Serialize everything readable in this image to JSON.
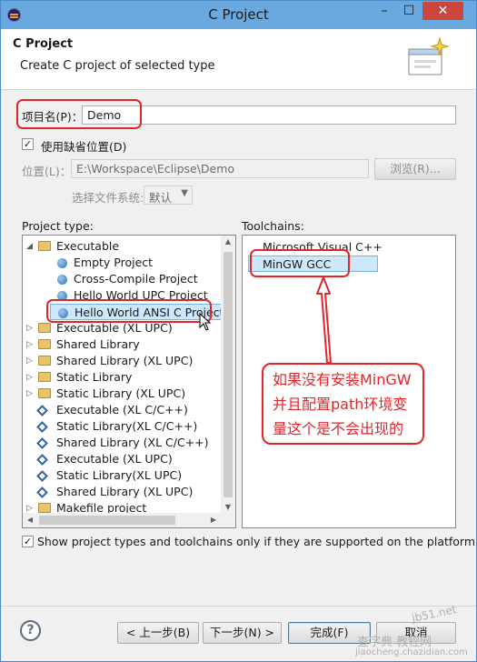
{
  "window": {
    "title": "C Project",
    "min": "–",
    "max": "☐",
    "close": "✕"
  },
  "header": {
    "title": "C Project",
    "description": "Create C project of selected type"
  },
  "project_name": {
    "label": "项目名(P)：",
    "value": "Demo"
  },
  "default_location": {
    "label": "使用缺省位置(D)",
    "checked": true
  },
  "location": {
    "label": "位置(L)：",
    "value": "E:\\Workspace\\Eclipse\\Demo",
    "browse": "浏览(R)..."
  },
  "filesystem": {
    "label": "选择文件系统:",
    "value": "默认"
  },
  "project_type": {
    "label": "Project type:",
    "items": [
      {
        "label": "Executable",
        "icon": "folder",
        "expander": "◢",
        "level": 0
      },
      {
        "label": "Empty Project",
        "icon": "circle",
        "level": 1
      },
      {
        "label": "Cross-Compile Project",
        "icon": "circle",
        "level": 1
      },
      {
        "label": "Hello World UPC Project",
        "icon": "circle",
        "level": 1
      },
      {
        "label": "Hello World ANSI C Project",
        "icon": "circle",
        "level": 1,
        "selected": true
      },
      {
        "label": "Executable (XL UPC)",
        "icon": "folder",
        "expander": "▷",
        "level": 0
      },
      {
        "label": "Shared Library",
        "icon": "folder",
        "expander": "▷",
        "level": 0
      },
      {
        "label": "Shared Library (XL UPC)",
        "icon": "folder",
        "expander": "▷",
        "level": 0
      },
      {
        "label": "Static Library",
        "icon": "folder",
        "expander": "▷",
        "level": 0
      },
      {
        "label": "Static Library (XL UPC)",
        "icon": "folder",
        "expander": "▷",
        "level": 0
      },
      {
        "label": "Executable (XL C/C++)",
        "icon": "diamond",
        "level": 0
      },
      {
        "label": "Static Library(XL C/C++)",
        "icon": "diamond",
        "level": 0
      },
      {
        "label": "Shared Library (XL C/C++)",
        "icon": "diamond",
        "level": 0
      },
      {
        "label": "Executable (XL UPC)",
        "icon": "diamond",
        "level": 0
      },
      {
        "label": "Static Library(XL UPC)",
        "icon": "diamond",
        "level": 0
      },
      {
        "label": "Shared Library (XL UPC)",
        "icon": "diamond",
        "level": 0
      },
      {
        "label": "Makefile project",
        "icon": "folder",
        "expander": "▷",
        "level": 0
      }
    ]
  },
  "toolchains": {
    "label": "Toolchains:",
    "items": [
      {
        "label": "Microsoft Visual C++"
      },
      {
        "label": "MinGW GCC",
        "selected": true
      }
    ]
  },
  "annotation": {
    "line1": "如果没有安装MinGW",
    "line2": "并且配置path环境变",
    "line3": "量这个是不会出现的"
  },
  "show_supported": {
    "label": "Show project types and toolchains only if they are supported on the platform",
    "checked": true
  },
  "buttons": {
    "help": "?",
    "back": "< 上一步(B)",
    "next": "下一步(N) >",
    "finish": "完成(F)",
    "cancel": "取消"
  },
  "watermark": {
    "line1": "查字典 教程网",
    "line2": "jiaocheng.chazidian.com",
    "line3": "jb51.net"
  },
  "colors": {
    "accent": "#e0262b",
    "selection": "#cde8fb"
  }
}
